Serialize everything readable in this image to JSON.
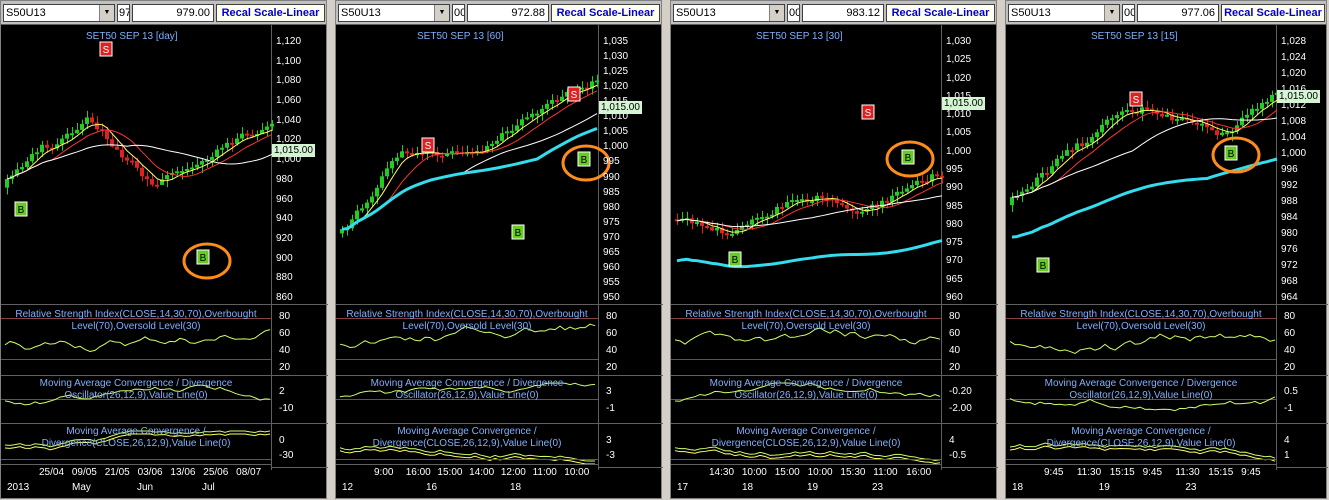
{
  "panels": [
    {
      "symbol": "S50U13",
      "field1": "97",
      "value": "979.00",
      "recal": "Recal Scale-Linear",
      "title": "SET50 SEP 13  [day]",
      "price_label": "1,015.00",
      "yticks": [
        "1,120",
        "1,100",
        "1,080",
        "1,060",
        "1,040",
        "1,020",
        "1,000",
        "980",
        "960",
        "940",
        "920",
        "900",
        "880",
        "860"
      ],
      "rsi_label": "Relative Strength Index(CLOSE,14,30,70),Overbought Level(70),Oversold Level(30)",
      "rsi_ticks": [
        "80",
        "60",
        "40",
        "20"
      ],
      "macd_osc_label": "Moving Average Convergence / Divergence Oscillator(26,12,9),Value Line(0)",
      "osc_ticks": [
        "2",
        "-10"
      ],
      "macd_label": "Moving Average Convergence / Divergence(CLOSE,26,12,9),Value Line(0)",
      "macd_ticks": [
        "0",
        "-30"
      ],
      "xdates": [
        "25/04",
        "09/05",
        "21/05",
        "03/06",
        "13/06",
        "25/06",
        "08/07"
      ],
      "xmonths": [
        "2013",
        "May",
        "Jun",
        "Jul"
      ],
      "signals": [
        {
          "t": "B"
        },
        {
          "t": "S"
        },
        {
          "t": "B"
        }
      ]
    },
    {
      "symbol": "S50U13",
      "field1": "00",
      "value": "972.88",
      "recal": "Recal Scale-Linear",
      "title": "SET50 SEP 13  [60]",
      "price_label": "1,015.00",
      "yticks": [
        "1,035",
        "1,030",
        "1,025",
        "1,020",
        "1,015",
        "1,010",
        "1,005",
        "1,000",
        "995",
        "990",
        "985",
        "980",
        "975",
        "970",
        "965",
        "960",
        "955",
        "950"
      ],
      "rsi_label": "Relative Strength Index(CLOSE,14,30,70),Overbought Level(70),Oversold Level(30)",
      "rsi_ticks": [
        "80",
        "60",
        "40",
        "20"
      ],
      "macd_osc_label": "Moving Average Convergence / Divergence Oscillator(26,12,9),Value Line(0)",
      "osc_ticks": [
        "3",
        "-1"
      ],
      "macd_label": "Moving Average Convergence / Divergence(CLOSE,26,12,9),Value Line(0)",
      "macd_ticks": [
        "3",
        "-3"
      ],
      "xdates": [
        "9:00",
        "16:00",
        "15:00",
        "14:00",
        "12:00",
        "11:00",
        "10:00"
      ],
      "xmonths": [
        "12",
        "16",
        "18"
      ],
      "signals": [
        {
          "t": "S"
        },
        {
          "t": "B"
        },
        {
          "t": "S"
        },
        {
          "t": "B"
        }
      ]
    },
    {
      "symbol": "S50U13",
      "field1": "00",
      "value": "983.12",
      "recal": "Recal Scale-Linear",
      "title": "SET50 SEP 13  [30]",
      "price_label": "1,015.00",
      "yticks": [
        "1,030",
        "1,025",
        "1,020",
        "1,015",
        "1,010",
        "1,005",
        "1,000",
        "995",
        "990",
        "985",
        "980",
        "975",
        "970",
        "965",
        "960"
      ],
      "rsi_label": "Relative Strength Index(CLOSE,14,30,70),Overbought Level(70),Oversold Level(30)",
      "rsi_ticks": [
        "80",
        "60",
        "40",
        "20"
      ],
      "macd_osc_label": "Moving Average Convergence / Divergence Oscillator(26,12,9),Value Line(0)",
      "osc_ticks": [
        "-0.20",
        "-2.00"
      ],
      "macd_label": "Moving Average Convergence / Divergence(CLOSE,26,12,9),Value Line(0)",
      "macd_ticks": [
        "4",
        "-0.5"
      ],
      "xdates": [
        "14:30",
        "10:00",
        "15:00",
        "10:00",
        "15:30",
        "11:00",
        "16:00"
      ],
      "xmonths": [
        "17",
        "18",
        "19",
        "23"
      ],
      "signals": [
        {
          "t": "B"
        },
        {
          "t": "S"
        },
        {
          "t": "B"
        }
      ]
    },
    {
      "symbol": "S50U13",
      "field1": "00",
      "value": "977.06",
      "recal": "Recal Scale-Linear",
      "title": "SET50 SEP 13  [15]",
      "price_label": "1,015.00",
      "yticks": [
        "1,028",
        "1,024",
        "1,020",
        "1,016",
        "1,012",
        "1,008",
        "1,004",
        "1,000",
        "996",
        "992",
        "988",
        "984",
        "980",
        "976",
        "972",
        "968",
        "964"
      ],
      "rsi_label": "Relative Strength Index(CLOSE,14,30,70),Overbought Level(70),Oversold Level(30)",
      "rsi_ticks": [
        "80",
        "60",
        "40",
        "20"
      ],
      "macd_osc_label": "Moving Average Convergence / Divergence Oscillator(26,12,9),Value Line(0)",
      "osc_ticks": [
        "0.5",
        "-1"
      ],
      "macd_label": "Moving Average Convergence / Divergence(CLOSE,26,12,9),Value Line(0)",
      "macd_ticks": [
        "4",
        "1"
      ],
      "xdates": [
        "9:45",
        "11:30",
        "15:15",
        "9:45",
        "11:30",
        "15:15",
        "9:45"
      ],
      "xmonths": [
        "18",
        "19",
        "23"
      ],
      "signals": [
        {
          "t": "B"
        },
        {
          "t": "S"
        },
        {
          "t": "B"
        }
      ]
    }
  ],
  "colors": {
    "bg": "#000000",
    "up": "#22cc22",
    "down": "#dd2222",
    "ma_fast": "#ffff66",
    "ma_mid": "#ff3333",
    "ma_slow": "#ffffff",
    "ma_long": "#33ddee",
    "buy": "#66cc22",
    "sell": "#dd2222",
    "circle": "#ff8c1a"
  },
  "icons": [
    "chevron-down-icon"
  ]
}
